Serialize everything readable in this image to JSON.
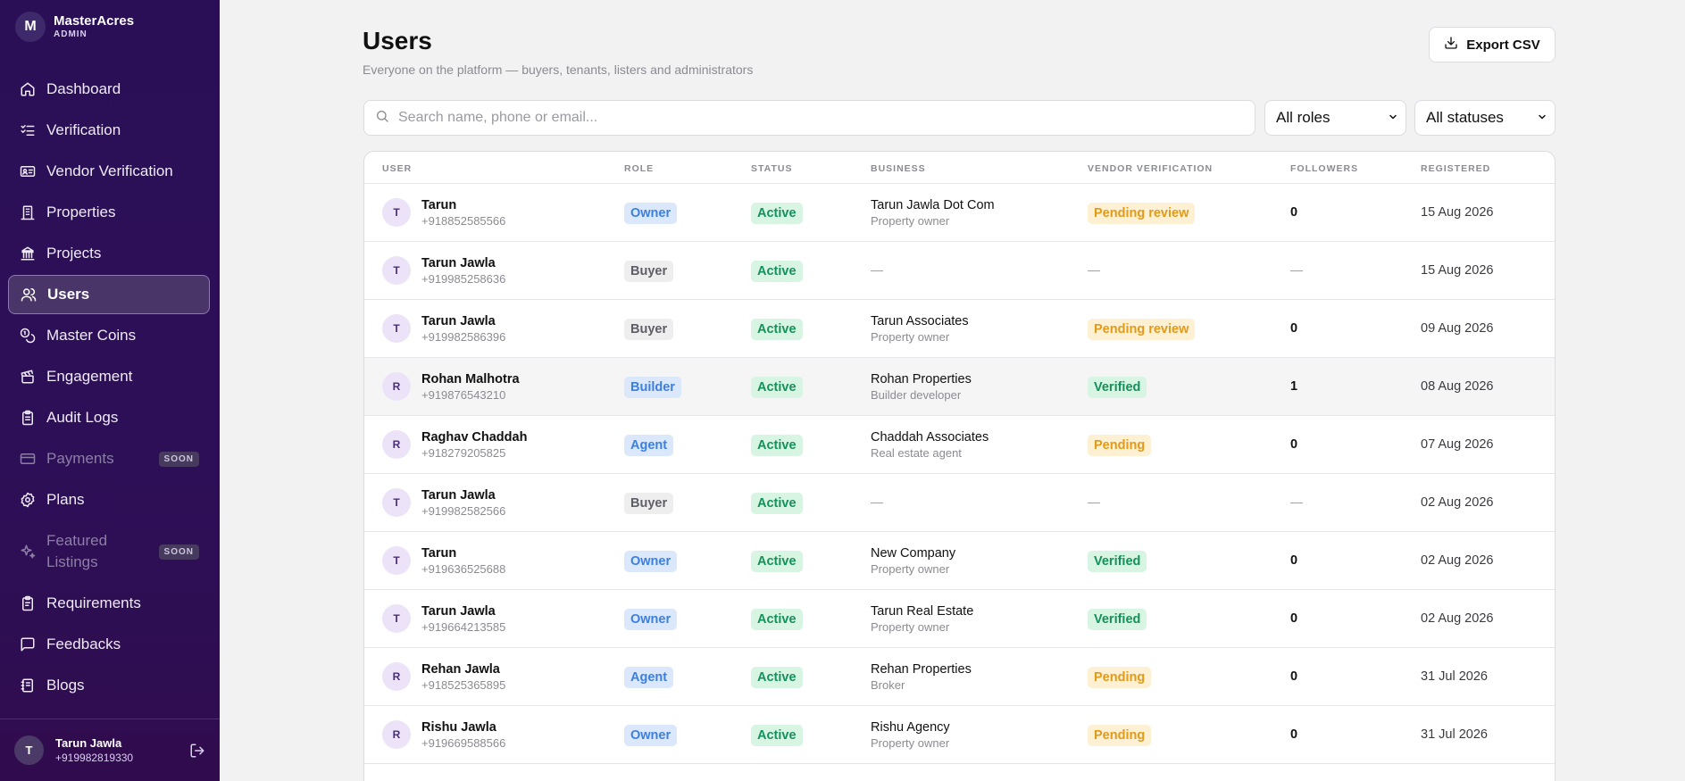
{
  "brand": {
    "logo_letter": "M",
    "name": "MasterAcres",
    "subtitle": "ADMIN"
  },
  "sidebar": {
    "items": [
      {
        "label": "Dashboard",
        "icon": "home-icon"
      },
      {
        "label": "Verification",
        "icon": "checklist-icon"
      },
      {
        "label": "Vendor Verification",
        "icon": "id-card-icon"
      },
      {
        "label": "Properties",
        "icon": "building-icon"
      },
      {
        "label": "Projects",
        "icon": "landmark-icon"
      },
      {
        "label": "Users",
        "icon": "users-icon",
        "active": true
      },
      {
        "label": "Master Coins",
        "icon": "coins-icon"
      },
      {
        "label": "Engagement",
        "icon": "clapperboard-icon"
      },
      {
        "label": "Audit Logs",
        "icon": "clipboard-icon"
      },
      {
        "label": "Payments",
        "icon": "credit-card-icon",
        "badge": "SOON"
      },
      {
        "label": "Plans",
        "icon": "badge-icon"
      },
      {
        "label": "Featured Listings",
        "icon": "sparkles-icon",
        "badge": "SOON"
      },
      {
        "label": "Requirements",
        "icon": "clipboard-list-icon"
      },
      {
        "label": "Feedbacks",
        "icon": "message-square-icon"
      },
      {
        "label": "Blogs",
        "icon": "notebook-icon"
      }
    ],
    "user": {
      "avatar_letter": "T",
      "name": "Tarun Jawla",
      "phone": "+919982819330"
    }
  },
  "header": {
    "title": "Users",
    "subtitle": "Everyone on the platform — buyers, tenants, listers and administrators",
    "export_label": "Export CSV"
  },
  "filters": {
    "search_placeholder": "Search name, phone or email...",
    "role_selected": "All roles",
    "status_selected": "All statuses"
  },
  "table": {
    "columns": [
      "USER",
      "ROLE",
      "STATUS",
      "BUSINESS",
      "VENDOR VERIFICATION",
      "FOLLOWERS",
      "REGISTERED"
    ],
    "rows": [
      {
        "initial": "T",
        "name": "Tarun",
        "phone": "+918852585566",
        "role": "Owner",
        "status": "Active",
        "business": "Tarun Jawla Dot Com",
        "business_type": "Property owner",
        "vendor": "Pending review",
        "followers": "0",
        "registered": "15 Aug 2026"
      },
      {
        "initial": "T",
        "name": "Tarun Jawla",
        "phone": "+919985258636",
        "role": "Buyer",
        "status": "Active",
        "business": "—",
        "business_type": "",
        "vendor": "—",
        "followers": "—",
        "registered": "15 Aug 2026"
      },
      {
        "initial": "T",
        "name": "Tarun Jawla",
        "phone": "+919982586396",
        "role": "Buyer",
        "status": "Active",
        "business": "Tarun Associates",
        "business_type": "Property owner",
        "vendor": "Pending review",
        "followers": "0",
        "registered": "09 Aug 2026"
      },
      {
        "initial": "R",
        "name": "Rohan Malhotra",
        "phone": "+919876543210",
        "role": "Builder",
        "status": "Active",
        "business": "Rohan Properties",
        "business_type": "Builder developer",
        "vendor": "Verified",
        "followers": "1",
        "registered": "08 Aug 2026"
      },
      {
        "initial": "R",
        "name": "Raghav Chaddah",
        "phone": "+918279205825",
        "role": "Agent",
        "status": "Active",
        "business": "Chaddah Associates",
        "business_type": "Real estate agent",
        "vendor": "Pending",
        "followers": "0",
        "registered": "07 Aug 2026"
      },
      {
        "initial": "T",
        "name": "Tarun Jawla",
        "phone": "+919982582566",
        "role": "Buyer",
        "status": "Active",
        "business": "—",
        "business_type": "",
        "vendor": "—",
        "followers": "—",
        "registered": "02 Aug 2026"
      },
      {
        "initial": "T",
        "name": "Tarun",
        "phone": "+919636525688",
        "role": "Owner",
        "status": "Active",
        "business": "New Company",
        "business_type": "Property owner",
        "vendor": "Verified",
        "followers": "0",
        "registered": "02 Aug 2026"
      },
      {
        "initial": "T",
        "name": "Tarun Jawla",
        "phone": "+919664213585",
        "role": "Owner",
        "status": "Active",
        "business": "Tarun Real Estate",
        "business_type": "Property owner",
        "vendor": "Verified",
        "followers": "0",
        "registered": "02 Aug 2026"
      },
      {
        "initial": "R",
        "name": "Rehan Jawla",
        "phone": "+918525365895",
        "role": "Agent",
        "status": "Active",
        "business": "Rehan Properties",
        "business_type": "Broker",
        "vendor": "Pending",
        "followers": "0",
        "registered": "31 Jul 2026"
      },
      {
        "initial": "R",
        "name": "Rishu Jawla",
        "phone": "+919669588566",
        "role": "Owner",
        "status": "Active",
        "business": "Rishu Agency",
        "business_type": "Property owner",
        "vendor": "Pending",
        "followers": "0",
        "registered": "31 Jul 2026"
      }
    ]
  }
}
